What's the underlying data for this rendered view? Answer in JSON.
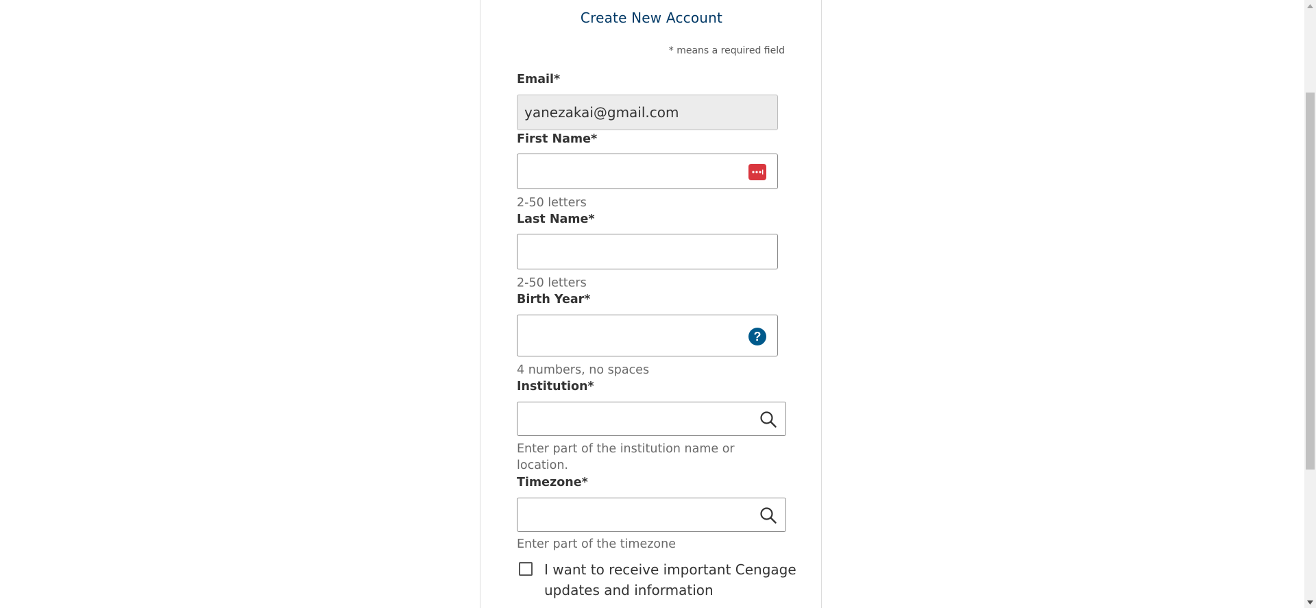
{
  "form": {
    "title": "Create New Account",
    "required_note": "* means a required field",
    "email": {
      "label": "Email*",
      "value": "yanezakai@gmail.com"
    },
    "first_name": {
      "label": "First Name*",
      "value": "",
      "hint": "2-50 letters"
    },
    "last_name": {
      "label": "Last Name*",
      "value": "",
      "hint": "2-50 letters"
    },
    "birth_year": {
      "label": "Birth Year*",
      "value": "",
      "hint": "4 numbers, no spaces"
    },
    "institution": {
      "label": "Institution*",
      "value": "",
      "hint": "Enter part of the institution name or location."
    },
    "timezone": {
      "label": "Timezone*",
      "value": "",
      "hint": "Enter part of the timezone"
    },
    "updates_opt_in": {
      "label": "I want to receive important Cengage updates and information",
      "checked": false
    }
  },
  "icons": {
    "password_manager": "password-manager-icon",
    "help": "help-icon",
    "search": "search-icon"
  },
  "colors": {
    "title": "#003865",
    "help_icon": "#005a8c",
    "password_icon": "#d9363e"
  }
}
